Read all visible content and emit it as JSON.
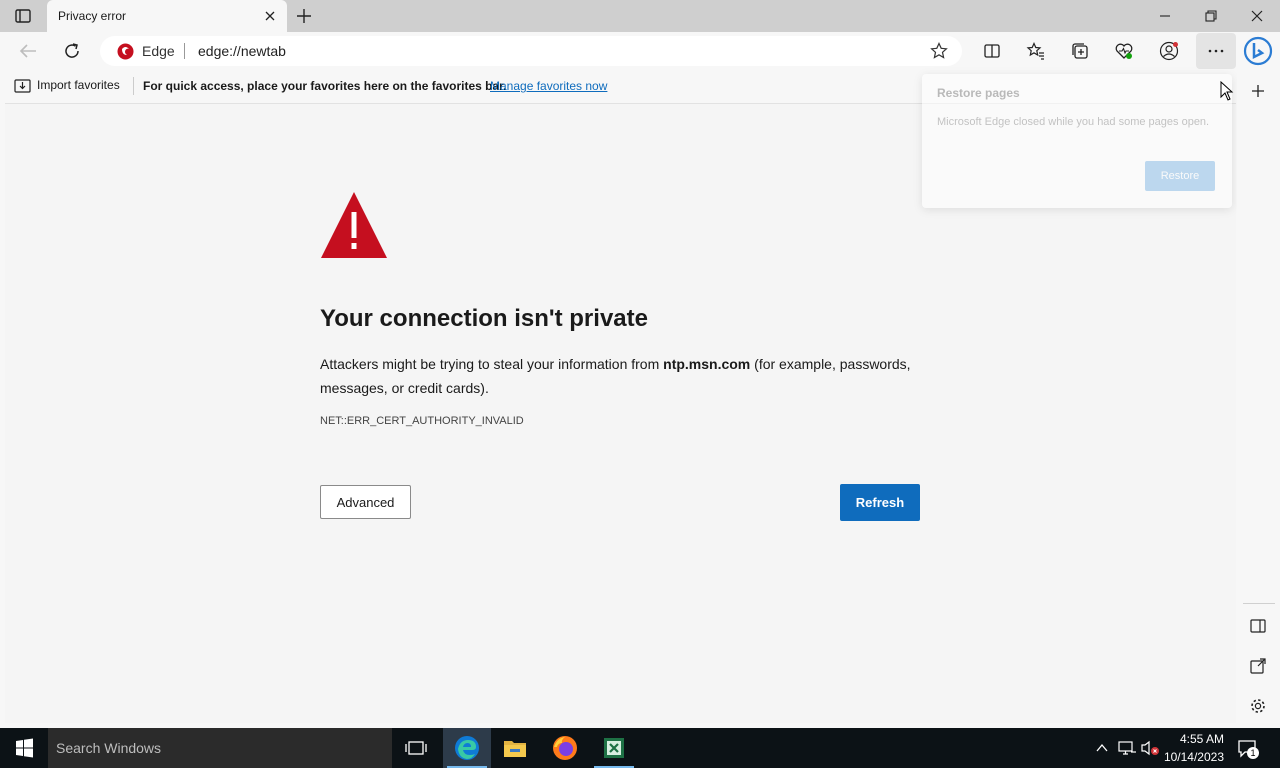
{
  "tab": {
    "title": "Privacy error"
  },
  "omnibox": {
    "site_label": "Edge",
    "url": "edge://newtab"
  },
  "favorites_bar": {
    "import_label": "Import favorites",
    "hint": "For quick access, place your favorites here on the favorites bar.",
    "manage_link": "Manage favorites now"
  },
  "error_page": {
    "heading": "Your connection isn't private",
    "desc_before": "Attackers might be trying to steal your information from ",
    "desc_host": "ntp.msn.com",
    "desc_after": " (for example, passwords, messages, or credit cards).",
    "error_code": "NET::ERR_CERT_AUTHORITY_INVALID",
    "advanced_label": "Advanced",
    "refresh_label": "Refresh",
    "warning_color": "#c50f1f",
    "accent_color": "#0f6cbd"
  },
  "restore_popup": {
    "title": "Restore pages",
    "message": "Microsoft Edge closed while you had some pages open.",
    "button_label": "Restore"
  },
  "taskbar": {
    "search_placeholder": "Search Windows",
    "time": "4:55 AM",
    "date": "10/14/2023",
    "notification_count": "1",
    "apps": [
      "task-view-icon",
      "edge-icon",
      "file-explorer-icon",
      "firefox-icon",
      "excel-icon"
    ]
  }
}
